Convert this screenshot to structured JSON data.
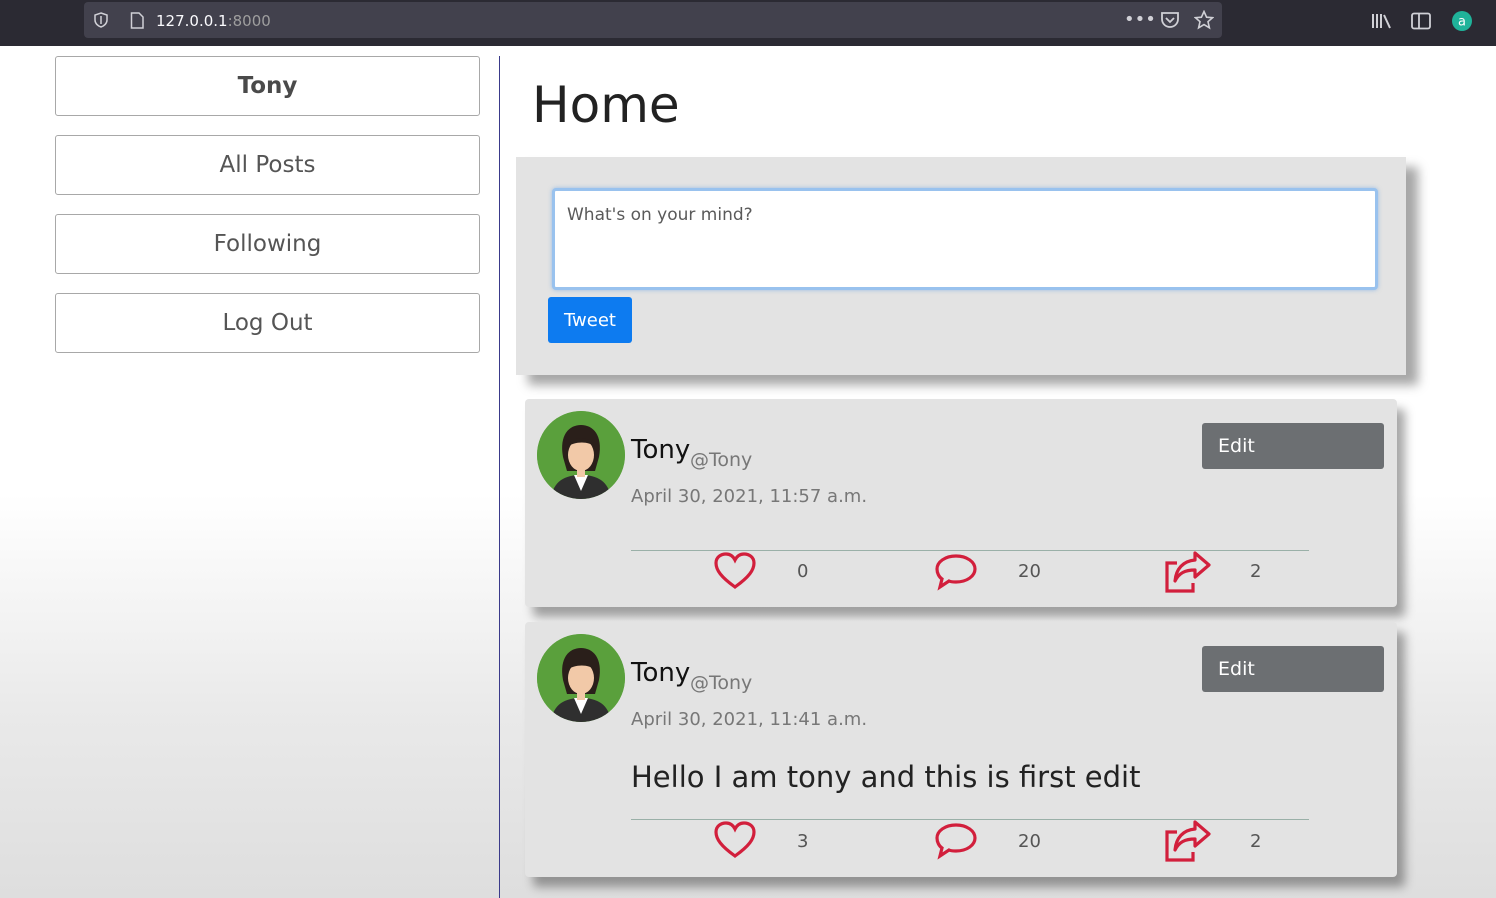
{
  "browser": {
    "url_host": "127.0.0.1",
    "url_port": ":8000"
  },
  "sidebar": {
    "items": [
      {
        "label": "Tony"
      },
      {
        "label": "All Posts"
      },
      {
        "label": "Following"
      },
      {
        "label": "Log Out"
      }
    ]
  },
  "main": {
    "title": "Home",
    "compose": {
      "placeholder": "What's on your mind?",
      "submit_label": "Tweet"
    },
    "posts": [
      {
        "author": "Tony",
        "handle": "@Tony",
        "timestamp": "April 30, 2021, 11:57 a.m.",
        "content": "",
        "edit_label": "Edit",
        "likes": "0",
        "comments": "20",
        "shares": "2"
      },
      {
        "author": "Tony",
        "handle": "@Tony",
        "timestamp": "April 30, 2021, 11:41 a.m.",
        "content": "Hello I am tony and this is first edit",
        "edit_label": "Edit",
        "likes": "3",
        "comments": "20",
        "shares": "2"
      }
    ]
  },
  "colors": {
    "accent": "#0d7bf0",
    "edit_button": "#6c6f72",
    "action_icon": "#d21f3c",
    "card_bg": "#e3e3e3"
  },
  "icons": [
    "shield-icon",
    "page-icon",
    "more-icon",
    "pocket-icon",
    "star-icon",
    "library-icon",
    "sidebar-icon",
    "account-icon",
    "heart-icon",
    "comment-icon",
    "share-icon"
  ]
}
